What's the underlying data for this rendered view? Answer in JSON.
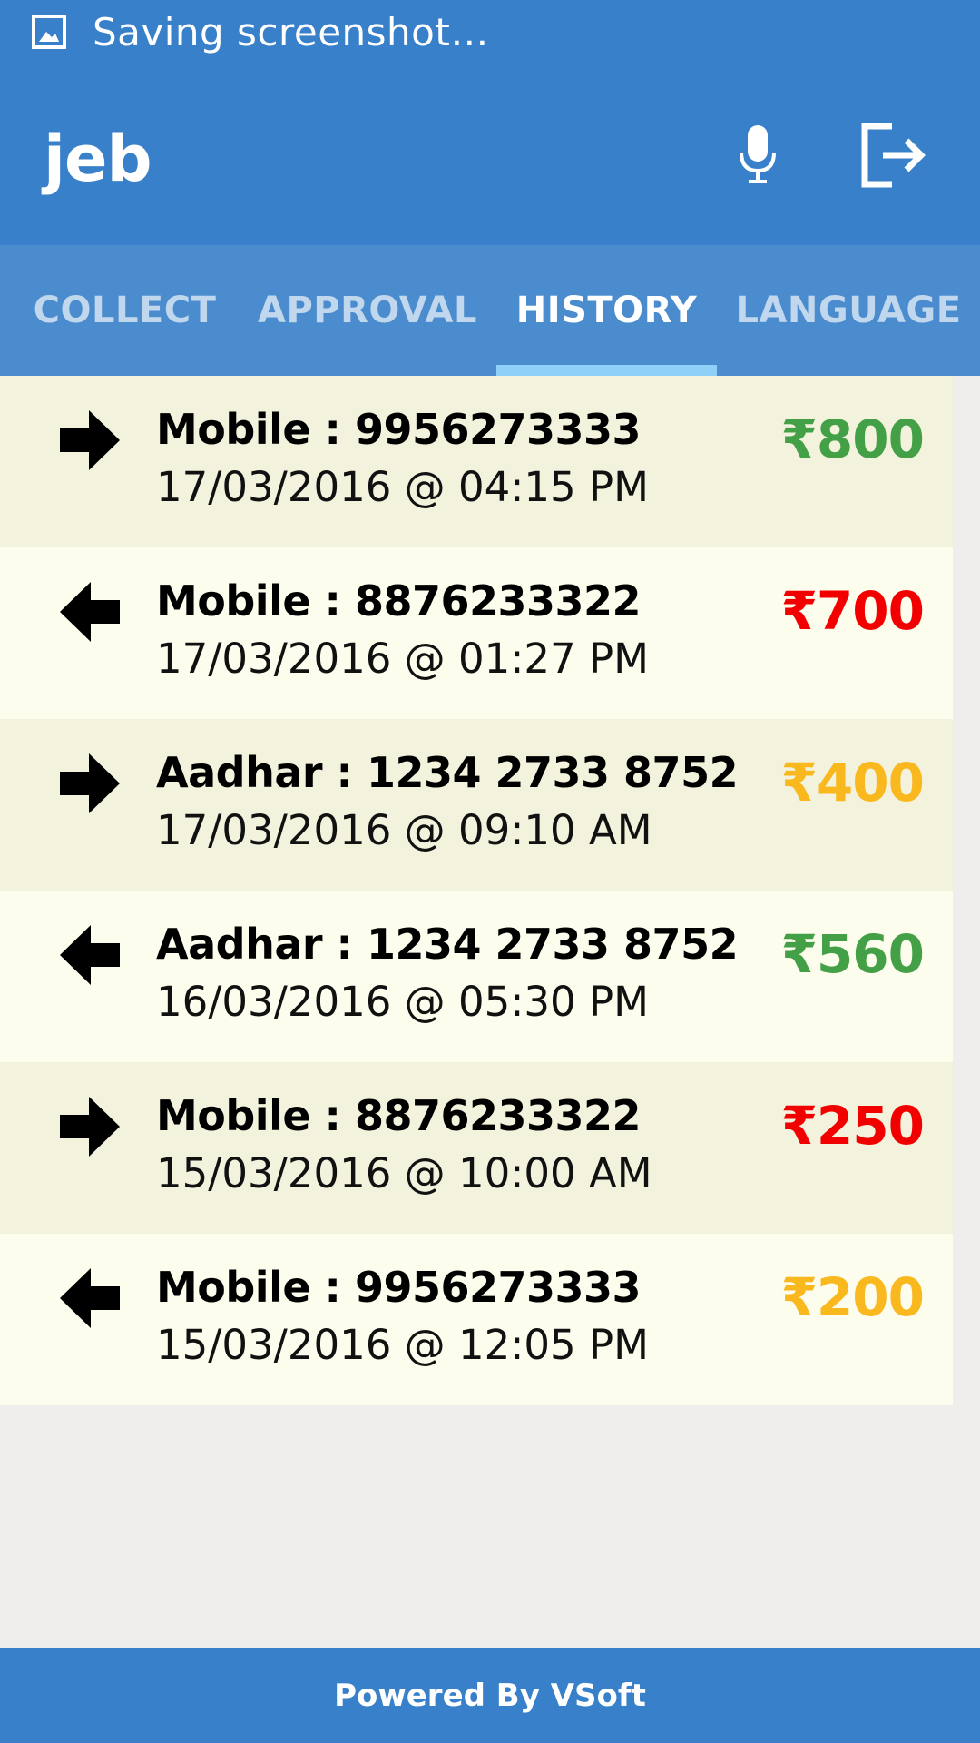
{
  "status_bar": {
    "text": "Saving screenshot…",
    "icon": "image-icon"
  },
  "app_bar": {
    "title": "jeb",
    "mic_icon": "microphone-icon",
    "logout_icon": "logout-icon"
  },
  "tabs": [
    {
      "label": "COLLECT",
      "active": false
    },
    {
      "label": "APPROVAL",
      "active": false
    },
    {
      "label": "HISTORY",
      "active": true
    },
    {
      "label": "LANGUAGE",
      "active": false
    }
  ],
  "history": [
    {
      "direction": "right",
      "title": "Mobile : 9956273333",
      "time": "17/03/2016 @ 04:15 PM",
      "amount": "₹800",
      "color": "#43a047"
    },
    {
      "direction": "left",
      "title": "Mobile : 8876233322",
      "time": "17/03/2016 @ 01:27 PM",
      "amount": "₹700",
      "color": "#f20000"
    },
    {
      "direction": "right",
      "title": "Aadhar : 1234 2733 8752",
      "time": "17/03/2016 @ 09:10 AM",
      "amount": "₹400",
      "color": "#f8b81e"
    },
    {
      "direction": "left",
      "title": "Aadhar : 1234 2733 8752",
      "time": "16/03/2016 @ 05:30 PM",
      "amount": "₹560",
      "color": "#43a047"
    },
    {
      "direction": "right",
      "title": "Mobile : 8876233322",
      "time": "15/03/2016 @ 10:00 AM",
      "amount": "₹250",
      "color": "#f20000"
    },
    {
      "direction": "left",
      "title": "Mobile : 9956273333",
      "time": "15/03/2016 @ 12:05 PM",
      "amount": "₹200",
      "color": "#f8b81e"
    }
  ],
  "footer": {
    "text": "Powered By VSoft"
  },
  "colors": {
    "primary": "#3880c9",
    "tab_bar": "#4a8ccd",
    "indicator": "#8fd0f8",
    "row_odd": "#f2f2dd",
    "row_even": "#fdfded"
  }
}
